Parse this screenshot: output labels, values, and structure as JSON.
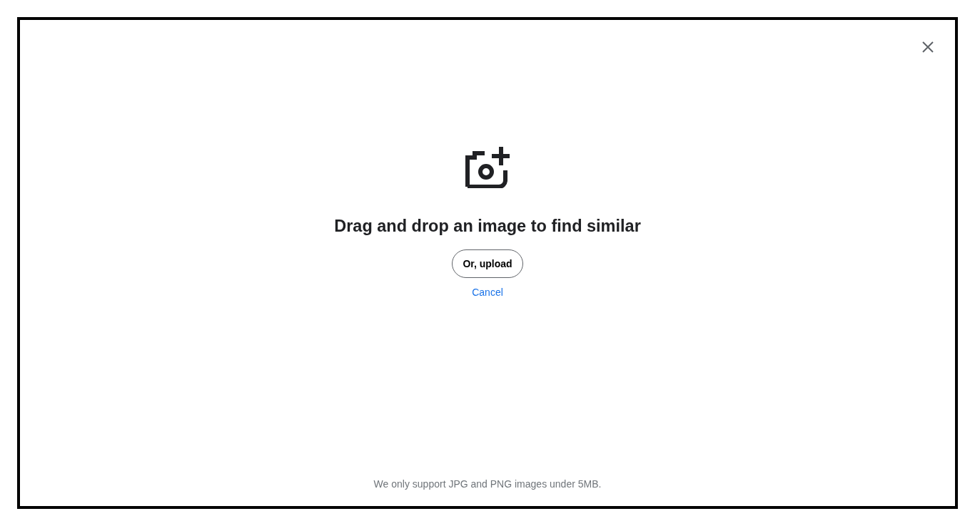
{
  "dialog": {
    "heading": "Drag and drop an image to find similar",
    "upload_button": "Or, upload",
    "cancel_link": "Cancel",
    "footnote": "We only support JPG and PNG images under 5MB."
  }
}
